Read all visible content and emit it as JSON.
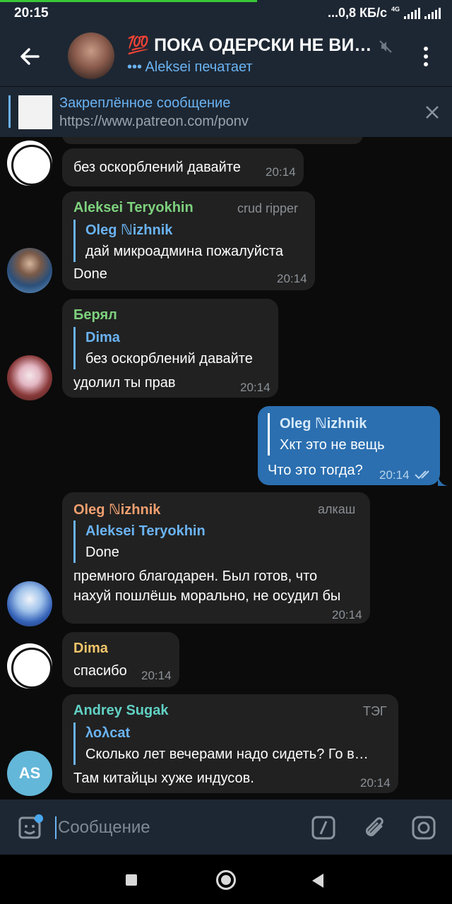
{
  "status": {
    "time": "20:15",
    "network": "...0,8 КБ/с",
    "net_type": "4G"
  },
  "header": {
    "title": "💯 ПОКА ОДЕРСКИ НЕ ВИ…",
    "subtitle": "••• Aleksei печатает"
  },
  "pinned": {
    "label": "Закреплённое сообщение",
    "text": "https://www.patreon.com/ponv"
  },
  "messages": [
    {
      "text": "без оскорблений давайте",
      "time": "20:14"
    },
    {
      "sender": "Aleksei Teryokhin",
      "tag": "crud ripper",
      "reply_name": "Oleg ℕizhnik",
      "reply_text": "дай микроадмина пожалуйста",
      "text": "Done",
      "time": "20:14"
    },
    {
      "sender": "Берял",
      "reply_name": "Dima",
      "reply_text": "без оскорблений давайте",
      "text": "удолил ты прав",
      "time": "20:14"
    },
    {
      "reply_name": "Oleg ℕizhnik",
      "reply_text": "Хкт это не вещь",
      "text": "Что это тогда?",
      "time": "20:14"
    },
    {
      "sender": "Oleg ℕizhnik",
      "tag": "алкаш",
      "reply_name": "Aleksei Teryokhin",
      "reply_text": "Done",
      "text_line1": "премного благодарен. Был готов, что",
      "text_line2": "нахуй пошлёшь морально, не осудил бы",
      "time": "20:14"
    },
    {
      "sender": "Dima",
      "text": "спасибо",
      "time": "20:14"
    },
    {
      "sender": "Andrey Sugak",
      "tag": "ТЭГ",
      "reply_name": "λολcat",
      "reply_text": "Сколько лет вечерами надо сидеть? Го в…",
      "text": "Там китайцы хуже индусов.",
      "time": "20:14",
      "avatar_initials": "AS"
    }
  ],
  "composer": {
    "placeholder": "Сообщение"
  },
  "colors": {
    "header_bg": "#1d2733",
    "accent": "#6ab3f3",
    "bubble_in": "#212121",
    "bubble_out": "#2b6fb0",
    "name_green": "#7ed17e",
    "name_orange": "#f0a070",
    "name_yellow": "#f2c56b",
    "name_teal": "#61d1c4"
  }
}
